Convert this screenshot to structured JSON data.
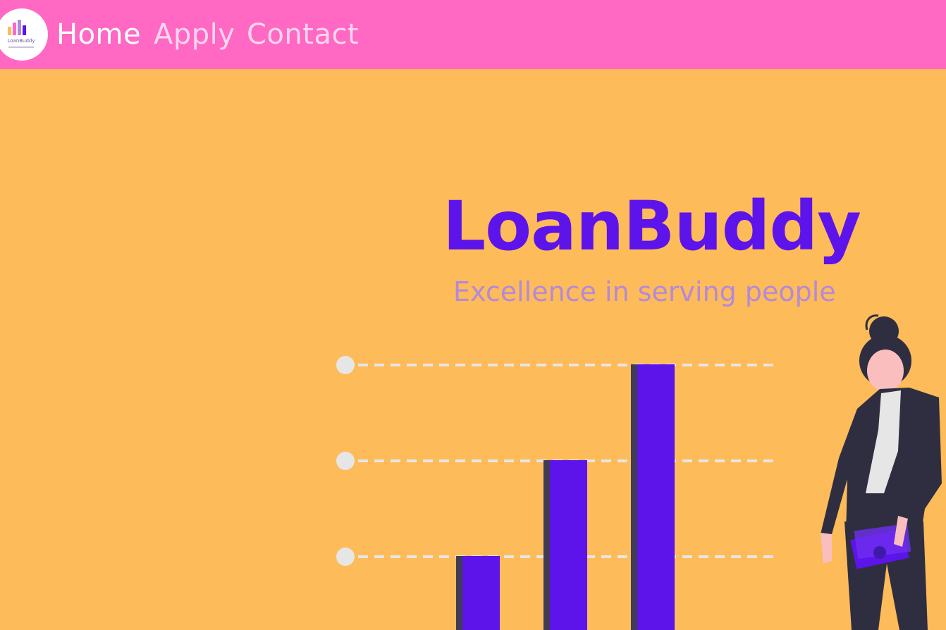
{
  "nav": {
    "logo_text": "LoanBuddy",
    "links": [
      {
        "label": "Home"
      },
      {
        "label": "Apply"
      },
      {
        "label": "Contact"
      }
    ]
  },
  "hero": {
    "title": "LoanBuddy",
    "tagline": "Excellence in serving people"
  },
  "colors": {
    "page_bg": "#fdbb5a",
    "nav_bg": "#ff68c3",
    "accent": "#5d14ea",
    "tagline": "#b48ad8"
  }
}
